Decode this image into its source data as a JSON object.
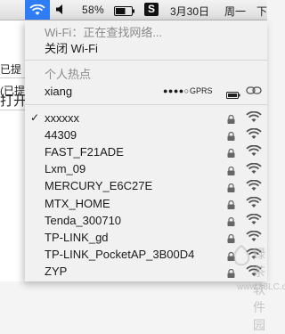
{
  "menubar": {
    "battery_percent": "58%",
    "app_badge": "S",
    "date": "3月30日",
    "weekday": "周一",
    "time_partial": "下"
  },
  "background_window": {
    "lines": [
      "已提",
      "(已提)",
      "打开"
    ]
  },
  "wifi_menu": {
    "status": "Wi-Fi：正在查找网络...",
    "toggle": "关闭 Wi-Fi",
    "hotspot_header": "个人热点",
    "hotspot": {
      "name": "xiang",
      "signal_dots": "●●●●○",
      "network_type": "GPRS"
    },
    "networks": [
      {
        "name": "xxxxxx",
        "connected": true
      },
      {
        "name": "44309",
        "connected": false
      },
      {
        "name": "FAST_F21ADE",
        "connected": false
      },
      {
        "name": "Lxm_09",
        "connected": false
      },
      {
        "name": "MERCURY_E6C27E",
        "connected": false
      },
      {
        "name": "MTX_HOME",
        "connected": false
      },
      {
        "name": "Tenda_300710",
        "connected": false
      },
      {
        "name": "TP-LINK_gd",
        "connected": false
      },
      {
        "name": "TP-LINK_PocketAP_3B00D4",
        "connected": false
      },
      {
        "name": "ZYP",
        "connected": false
      }
    ],
    "check_mark": "✓"
  },
  "watermark": {
    "text": "绿茶软件园",
    "url": "www.33LC.com"
  },
  "colors": {
    "highlight": "#2f7df6",
    "menu_bg": "#f1f1f1",
    "separator": "#d6d6d6"
  }
}
